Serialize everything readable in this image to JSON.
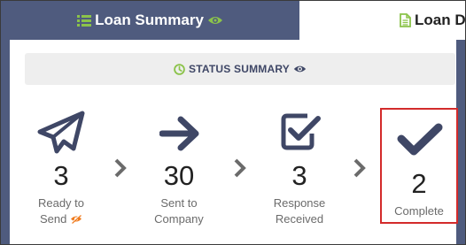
{
  "tabs": [
    {
      "label": "Loan Summary",
      "active": true,
      "icon": "list-icon",
      "trailing_icon": "eye-icon"
    },
    {
      "label": "Loan D",
      "active": false,
      "icon": "document-icon"
    }
  ],
  "status_summary": {
    "title": "STATUS SUMMARY",
    "icon": "clock-icon",
    "trailing_icon": "eye-icon"
  },
  "stages": [
    {
      "count": "3",
      "label_line1": "Ready to",
      "label_line2": "Send",
      "icon": "paper-plane-icon",
      "badge_icon": "eye-slash-icon"
    },
    {
      "count": "30",
      "label_line1": "Sent to",
      "label_line2": "Company",
      "icon": "arrow-right-icon"
    },
    {
      "count": "3",
      "label_line1": "Response",
      "label_line2": "Received",
      "icon": "check-square-icon"
    },
    {
      "count": "2",
      "label_line1": "Complete",
      "label_line2": "",
      "icon": "checkmark-icon",
      "highlighted": true
    }
  ],
  "colors": {
    "tab_active_bg": "#4f5b7e",
    "icon_navy": "#3f4766",
    "accent_green": "#8bc34a",
    "badge_orange": "#f07b1d",
    "highlight_red": "#d32b2b",
    "chevron_gray": "#6b6b6b"
  }
}
